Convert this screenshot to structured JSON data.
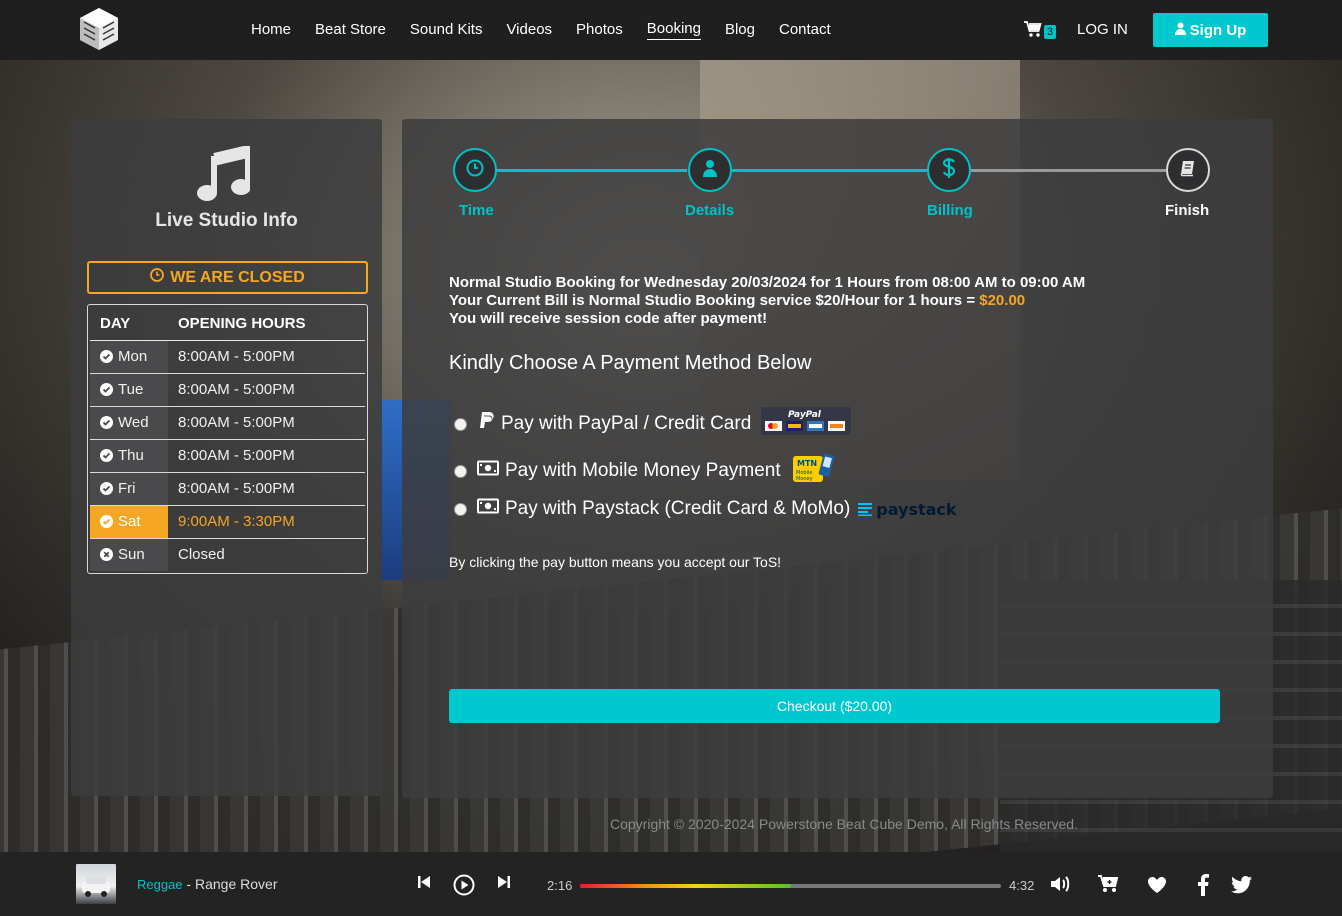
{
  "nav": {
    "logo_icon": "cube-logo-icon",
    "links": [
      "Home",
      "Beat Store",
      "Sound Kits",
      "Videos",
      "Photos",
      "Booking",
      "Blog",
      "Contact"
    ],
    "active": "Booking",
    "cart_count": "3",
    "login": "LOG IN",
    "signup": "Sign Up"
  },
  "studio": {
    "title": "Live Studio Info",
    "status": "WE ARE CLOSED",
    "header_day": "DAY",
    "header_hours": "OPENING HOURS",
    "days": [
      {
        "day": "Mon",
        "hours": "8:00AM - 5:00PM",
        "icon": "check-circle-icon"
      },
      {
        "day": "Tue",
        "hours": "8:00AM - 5:00PM",
        "icon": "check-circle-icon"
      },
      {
        "day": "Wed",
        "hours": "8:00AM - 5:00PM",
        "icon": "check-circle-icon"
      },
      {
        "day": "Thu",
        "hours": "8:00AM - 5:00PM",
        "icon": "check-circle-icon"
      },
      {
        "day": "Fri",
        "hours": "8:00AM - 5:00PM",
        "icon": "check-circle-icon"
      },
      {
        "day": "Sat",
        "hours": "9:00AM - 3:30PM",
        "icon": "check-circle-icon"
      },
      {
        "day": "Sun",
        "hours": "Closed",
        "icon": "x-circle-icon"
      }
    ]
  },
  "steps": [
    {
      "label": "Time",
      "icon": "clock-icon"
    },
    {
      "label": "Details",
      "icon": "user-icon"
    },
    {
      "label": "Billing",
      "icon": "dollar-icon"
    },
    {
      "label": "Finish",
      "icon": "book-icon"
    }
  ],
  "booking": {
    "line1": "Normal Studio Booking for Wednesday 20/03/2024 for 1 Hours from 08:00 AM to 09:00 AM",
    "line2_prefix": "Your Current Bill is Normal Studio Booking service $20/Hour for 1 hours = ",
    "line2_amount": "$20.00",
    "line3": "You will receive session code after payment!",
    "choose": "Kindly Choose A Payment Method Below",
    "options": [
      {
        "label": "Pay with PayPal / Credit Card",
        "badge": "PayPal"
      },
      {
        "label": "Pay with Mobile Money Payment",
        "badge": "MTN Mobile Money"
      },
      {
        "label": "Pay with Paystack (Credit Card & MoMo)",
        "badge": "paystack"
      }
    ],
    "tos": "By clicking the pay button means you accept our ToS!",
    "checkout": "Checkout ($20.00)"
  },
  "footer": {
    "copyright": "Copyright © 2020-2024 Powerstone Beat Cube Demo, All Rights Reserved."
  },
  "player": {
    "genre": "Reggae",
    "separator": " - ",
    "title": "Range Rover",
    "current": "2:16",
    "duration": "4:32",
    "progress": 0.5
  },
  "colors": {
    "accent": "#00c8cf",
    "warning": "#f5a623"
  }
}
